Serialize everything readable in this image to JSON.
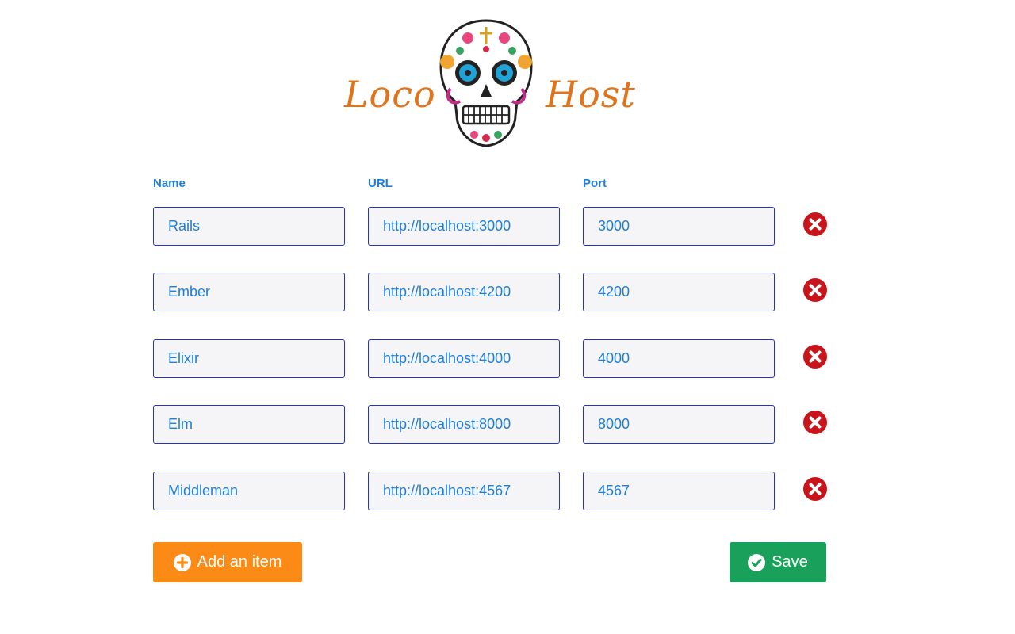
{
  "logo": {
    "word_left": "Loco",
    "word_right": "Host",
    "icon": "sugar-skull-icon"
  },
  "columns": {
    "name": "Name",
    "url": "URL",
    "port": "Port"
  },
  "rows": [
    {
      "name": "Rails",
      "url": "http://localhost:3000",
      "port": "3000"
    },
    {
      "name": "Ember",
      "url": "http://localhost:4200",
      "port": "4200"
    },
    {
      "name": "Elixir",
      "url": "http://localhost:4000",
      "port": "4000"
    },
    {
      "name": "Elm",
      "url": "http://localhost:8000",
      "port": "8000"
    },
    {
      "name": "Middleman",
      "url": "http://localhost:4567",
      "port": "4567"
    }
  ],
  "actions": {
    "add_label": "Add an item",
    "add_icon": "plus-circle-icon",
    "save_label": "Save",
    "save_icon": "check-circle-icon",
    "remove_icon": "times-circle-icon"
  },
  "colors": {
    "accent_text": "#1f7ed6",
    "field_border": "#2733b8",
    "add_button": "#fb8a16",
    "save_button": "#19a05a",
    "remove_icon": "#c8151c",
    "logo_text": "#e0741c"
  }
}
